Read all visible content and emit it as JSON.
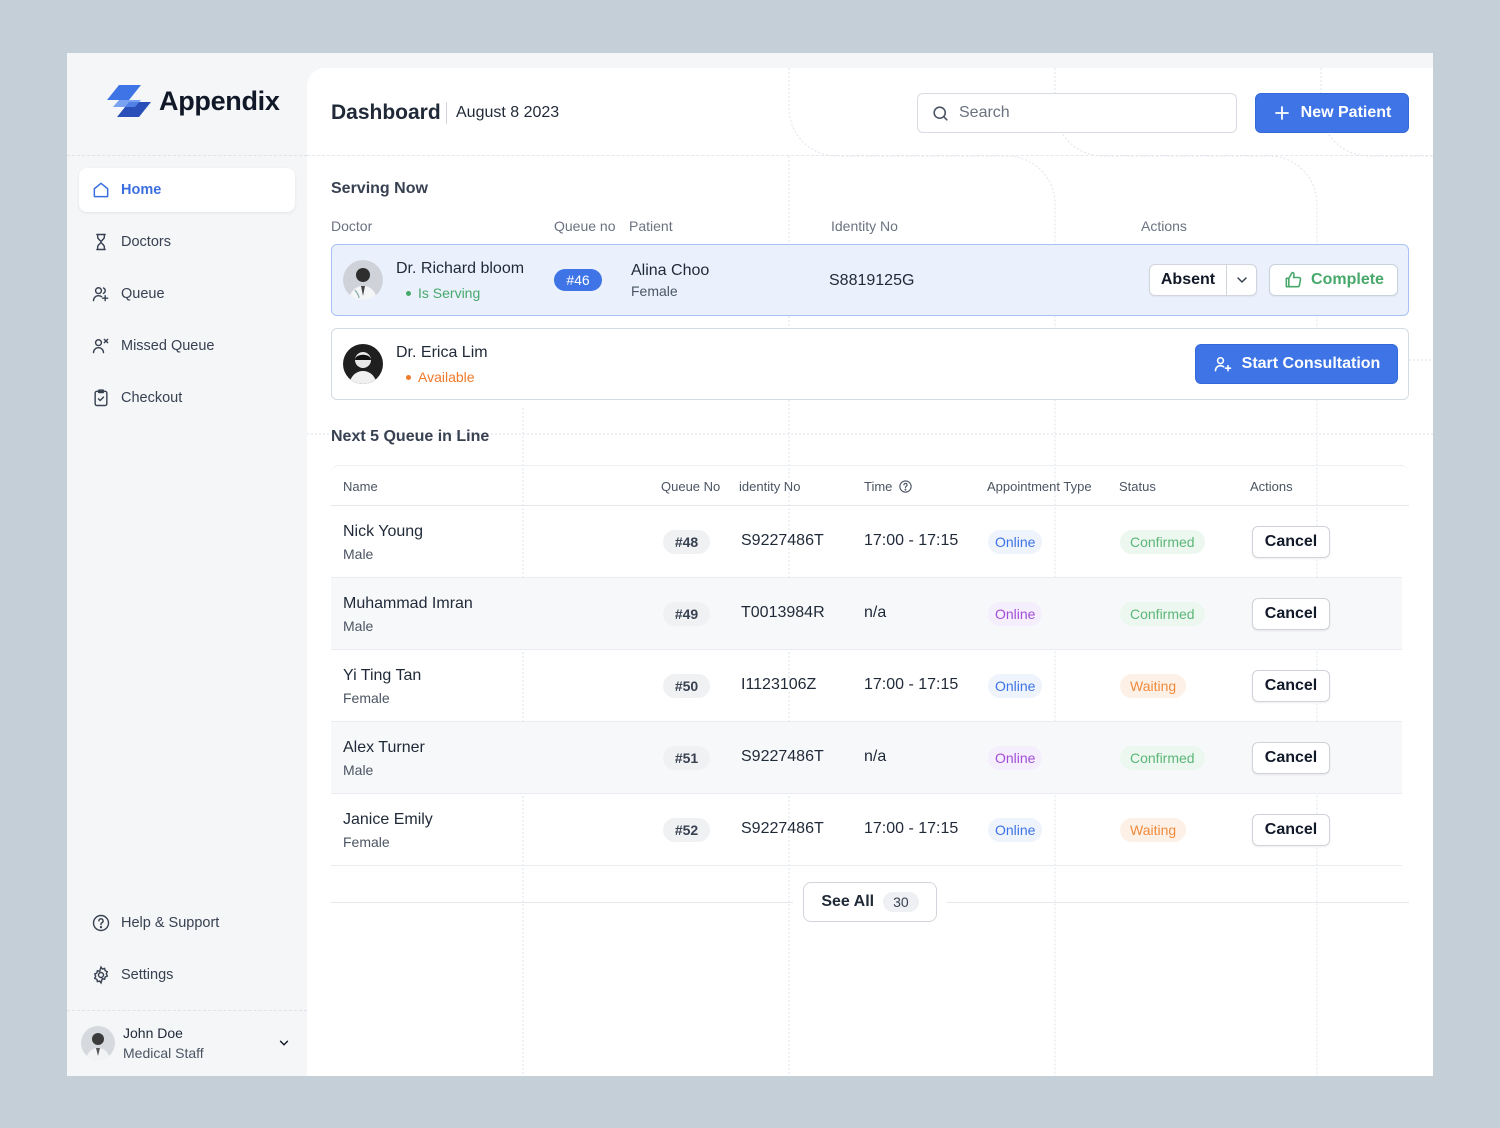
{
  "app": {
    "name": "Appendix"
  },
  "sidebar": {
    "items": [
      {
        "label": "Home",
        "icon": "home-icon",
        "active": true
      },
      {
        "label": "Doctors",
        "icon": "hourglass-icon"
      },
      {
        "label": "Queue",
        "icon": "users-plus-icon"
      },
      {
        "label": "Missed Queue",
        "icon": "user-x-icon"
      },
      {
        "label": "Checkout",
        "icon": "clipboard-check-icon"
      }
    ],
    "bottom": [
      {
        "label": "Help & Support",
        "icon": "help-circle-icon"
      },
      {
        "label": "Settings",
        "icon": "gear-icon"
      }
    ],
    "user": {
      "name": "John Doe",
      "role": "Medical Staff"
    }
  },
  "header": {
    "title": "Dashboard",
    "date": "August 8 2023",
    "search_placeholder": "Search",
    "new_patient": "New Patient"
  },
  "serving": {
    "title": "Serving Now",
    "columns": {
      "doctor": "Doctor",
      "queue": "Queue no",
      "patient": "Patient",
      "identity": "Identity No",
      "actions": "Actions"
    },
    "active": {
      "doctor": "Dr. Richard bloom",
      "status": "Is Serving",
      "queue": "#46",
      "patient": "Alina Choo",
      "sex": "Female",
      "identity": "S8819125G",
      "absent": "Absent",
      "complete": "Complete"
    },
    "available": {
      "doctor": "Dr. Erica Lim",
      "status": "Available",
      "start": "Start Consultation"
    }
  },
  "queue": {
    "title": "Next 5 Queue in Line",
    "columns": {
      "name": "Name",
      "queue": "Queue No",
      "identity": "identity No",
      "time": "Time",
      "type": "Appointment Type",
      "status": "Status",
      "actions": "Actions"
    },
    "rows": [
      {
        "name": "Nick Young",
        "sex": "Male",
        "queue": "#48",
        "identity": "S9227486T",
        "time": "17:00 - 17:15",
        "type": "Online",
        "status": "Confirmed",
        "action": "Cancel"
      },
      {
        "name": "Muhammad Imran",
        "sex": "Male",
        "queue": "#49",
        "identity": "T0013984R",
        "time": "n/a",
        "type": "Online",
        "status": "Confirmed",
        "action": "Cancel"
      },
      {
        "name": "Yi Ting Tan",
        "sex": "Female",
        "queue": "#50",
        "identity": "I1123106Z",
        "time": "17:00 - 17:15",
        "type": "Online",
        "status": "Waiting",
        "action": "Cancel"
      },
      {
        "name": "Alex Turner",
        "sex": "Male",
        "queue": "#51",
        "identity": "S9227486T",
        "time": "n/a",
        "type": "Online",
        "status": "Confirmed",
        "action": "Cancel"
      },
      {
        "name": "Janice Emily",
        "sex": "Female",
        "queue": "#52",
        "identity": "S9227486T",
        "time": "17:00 - 17:15",
        "type": "Online",
        "status": "Waiting",
        "action": "Cancel"
      }
    ],
    "see_all": "See All",
    "total": "30"
  },
  "colors": {
    "accent": "#3e74e6",
    "serving_green": "#47a86b",
    "available_orange": "#f07a2a",
    "online_blue": "#3e74e6",
    "online_purple": "#a24fd8",
    "confirmed_green": "#5cb679",
    "waiting_orange": "#ef8a3c"
  }
}
